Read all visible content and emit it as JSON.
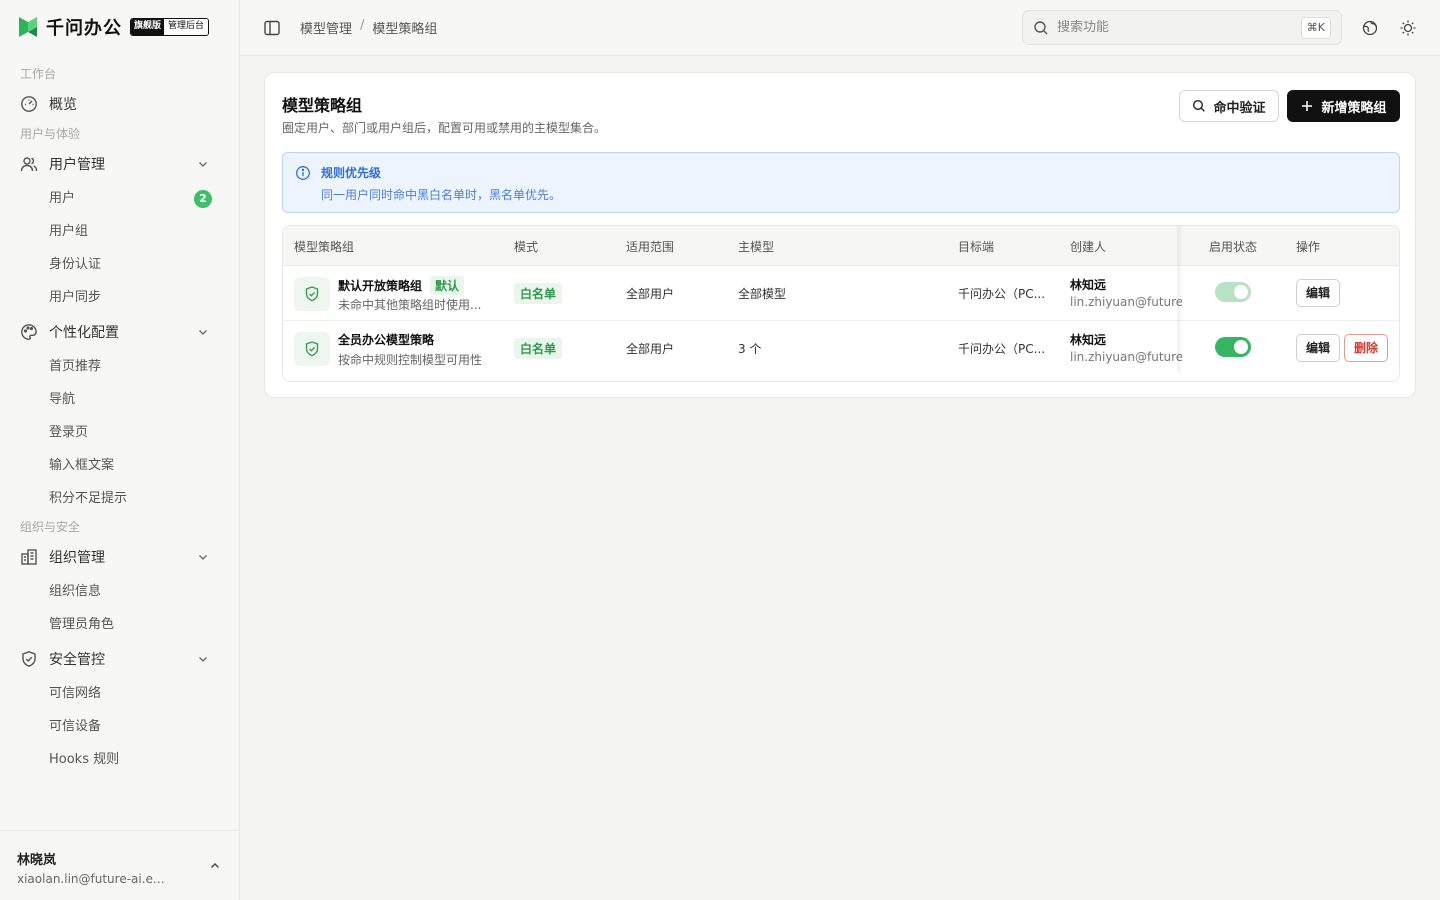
{
  "brand": {
    "name": "千问办公",
    "badge_edition": "旗舰版",
    "badge_console": "管理后台",
    "accent": "#3fbf6a"
  },
  "sidebar": {
    "sections": [
      {
        "label": "工作台"
      },
      {
        "label": "用户与体验"
      },
      {
        "label": "组织与安全"
      }
    ],
    "overview": {
      "label": "概览",
      "icon": "gauge-icon"
    },
    "user_mgmt": {
      "label": "用户管理",
      "icon": "users-icon",
      "items": [
        {
          "label": "用户",
          "count": "2"
        },
        {
          "label": "用户组"
        },
        {
          "label": "身份认证"
        },
        {
          "label": "用户同步"
        }
      ]
    },
    "personal": {
      "label": "个性化配置",
      "icon": "palette-icon",
      "items": [
        {
          "label": "首页推荐"
        },
        {
          "label": "导航"
        },
        {
          "label": "登录页"
        },
        {
          "label": "输入框文案"
        },
        {
          "label": "积分不足提示"
        }
      ]
    },
    "org_mgmt": {
      "label": "组织管理",
      "icon": "building-icon",
      "items": [
        {
          "label": "组织信息"
        },
        {
          "label": "管理员角色"
        }
      ]
    },
    "security": {
      "label": "安全管控",
      "icon": "shield-icon",
      "items": [
        {
          "label": "可信网络"
        },
        {
          "label": "可信设备"
        },
        {
          "label": "Hooks 规则"
        }
      ]
    },
    "user": {
      "name": "林晓岚",
      "email": "xiaolan.lin@future-ai.ex..."
    }
  },
  "header": {
    "breadcrumb": [
      "模型管理",
      "模型策略组"
    ],
    "breadcrumb_sep": "/",
    "search_placeholder": "搜索功能",
    "search_shortcut": "⌘K"
  },
  "page": {
    "title": "模型策略组",
    "subtitle": "圈定用户、部门或用户组后，配置可用或禁用的主模型集合。",
    "verify_button": "命中验证",
    "add_button": "新增策略组",
    "notice": {
      "title": "规则优先级",
      "text": "同一用户同时命中黑白名单时，黑名单优先。"
    }
  },
  "table": {
    "headers": [
      "模型策略组",
      "模式",
      "适用范围",
      "主模型",
      "目标端",
      "创建人",
      "启用状态",
      "操作"
    ],
    "rows": [
      {
        "name": "默认开放策略组",
        "default_tag": "默认",
        "desc": "未命中其他策略组时使用...",
        "mode": "白名单",
        "scope": "全部用户",
        "model": "全部模型",
        "target": "千问办公（PC...",
        "creator": "林知远",
        "creator_email": "lin.zhiyuan@future-ai",
        "enabled": true,
        "toggle_locked": true,
        "edit": "编辑"
      },
      {
        "name": "全员办公模型策略",
        "desc": "按命中规则控制模型可用性",
        "mode": "白名单",
        "scope": "全部用户",
        "model": "3 个",
        "target": "千问办公（PC...",
        "creator": "林知远",
        "creator_email": "lin.zhiyuan@future-ai",
        "enabled": true,
        "toggle_locked": false,
        "edit": "编辑",
        "delete": "删除"
      }
    ]
  },
  "colors": {
    "success": "#36b662",
    "danger": "#d83a32",
    "info": "#2f6fd6",
    "primary_button": "#111111"
  }
}
